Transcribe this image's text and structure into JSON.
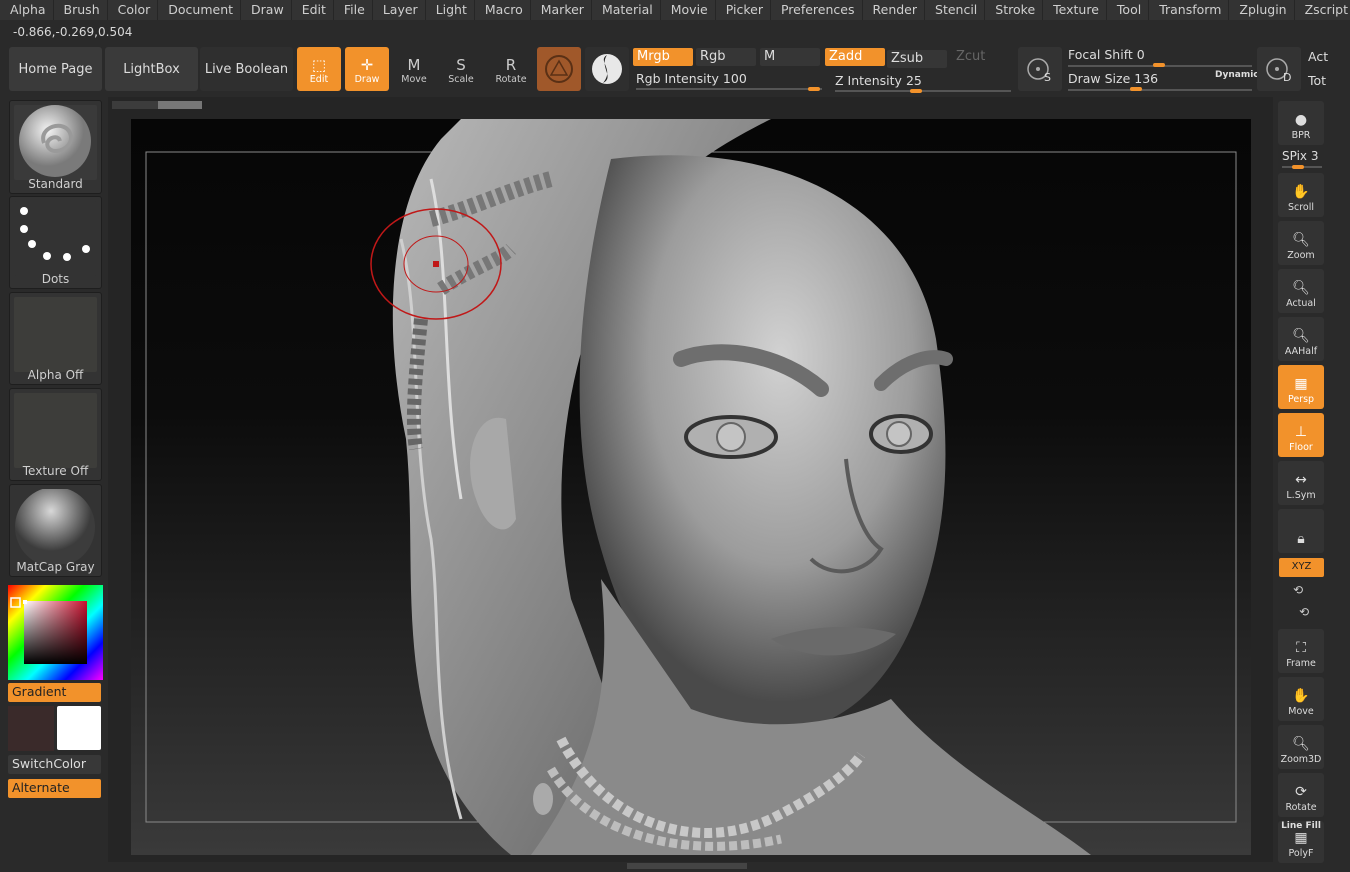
{
  "menu": [
    "Alpha",
    "Brush",
    "Color",
    "Document",
    "Draw",
    "Edit",
    "File",
    "Layer",
    "Light",
    "Macro",
    "Marker",
    "Material",
    "Movie",
    "Picker",
    "Preferences",
    "Render",
    "Stencil",
    "Stroke",
    "Texture",
    "Tool",
    "Transform",
    "Zplugin",
    "Zscript"
  ],
  "coords": "-0.866,-0.269,0.504",
  "shelf": {
    "home": "Home Page",
    "lightbox": "LightBox",
    "live_boolean": "Live Boolean"
  },
  "tools": {
    "edit": "Edit",
    "draw": "Draw",
    "move": "Move",
    "scale": "Scale",
    "rotate": "Rotate"
  },
  "channels": {
    "mrgb": "Mrgb",
    "rgb": "Rgb",
    "m": "M",
    "zadd": "Zadd",
    "zsub": "Zsub",
    "zcut": "Zcut"
  },
  "intensity": {
    "rgb_label": "Rgb Intensity",
    "rgb_value": "100",
    "z_label": "Z Intensity",
    "z_value": "25",
    "focal_label": "Focal Shift",
    "focal_value": "0",
    "draw_label": "Draw Size",
    "draw_value": "136",
    "dynamic": "Dynamic",
    "act": "Act",
    "tot": "Tot"
  },
  "left_panel": {
    "brush": "Standard",
    "stroke": "Dots",
    "alpha": "Alpha Off",
    "texture": "Texture Off",
    "material": "MatCap Gray",
    "gradient": "Gradient",
    "switchcolor": "SwitchColor",
    "alternate": "Alternate"
  },
  "right_panel": {
    "bpr": "BPR",
    "spix_label": "SPix",
    "spix_value": "3",
    "scroll": "Scroll",
    "zoom": "Zoom",
    "actual": "Actual",
    "aahalf": "AAHalf",
    "persp": "Persp",
    "floor": "Floor",
    "lsym": "L.Sym",
    "xyz": "XYZ",
    "frame": "Frame",
    "move": "Move",
    "zoom3d": "Zoom3D",
    "rotate": "Rotate",
    "linefill": "Line Fill",
    "polyf": "PolyF"
  },
  "colors": {
    "accent": "#f2922b",
    "panel": "#333333",
    "background": "#2a2a2a"
  }
}
